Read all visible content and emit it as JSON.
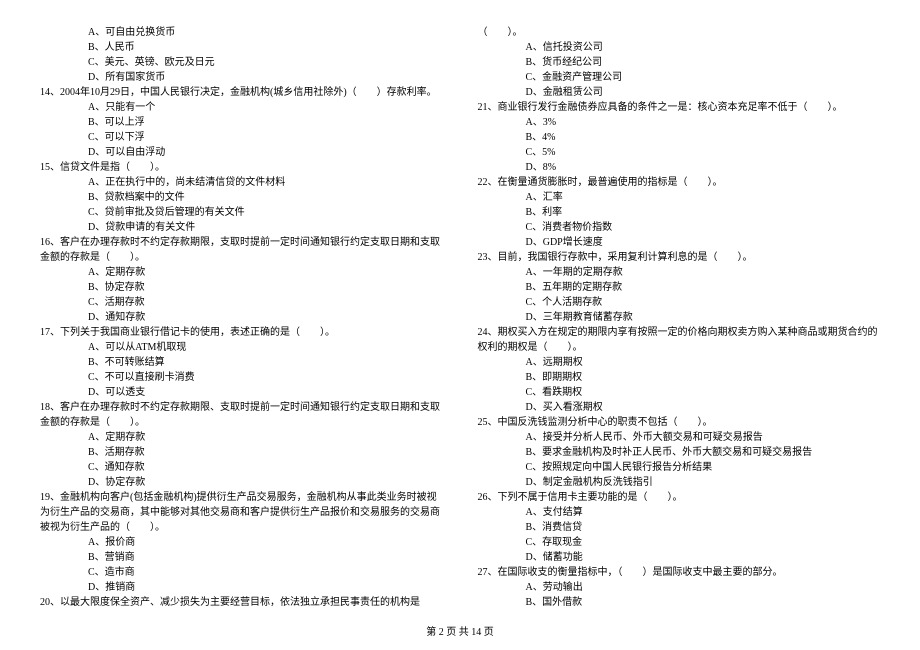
{
  "left": {
    "opts13": [
      "A、可自由兑换货币",
      "B、人民币",
      "C、美元、英镑、欧元及日元",
      "D、所有国家货币"
    ],
    "q14": "14、2004年10月29日，中国人民银行决定，金融机构(城乡信用社除外)（　　）存款利率。",
    "opts14": [
      "A、只能有一个",
      "B、可以上浮",
      "C、可以下浮",
      "D、可以自由浮动"
    ],
    "q15": "15、信贷文件是指（　　）。",
    "opts15": [
      "A、正在执行中的，尚未结清信贷的文件材料",
      "B、贷款档案中的文件",
      "C、贷前审批及贷后管理的有关文件",
      "D、贷款申请的有关文件"
    ],
    "q16": "16、客户在办理存款时不约定存款期限，支取时提前一定时间通知银行约定支取日期和支取金额的存款是（　　）。",
    "opts16": [
      "A、定期存款",
      "B、协定存款",
      "C、活期存款",
      "D、通知存款"
    ],
    "q17": "17、下列关于我国商业银行借记卡的使用，表述正确的是（　　）。",
    "opts17": [
      "A、可以从ATM机取现",
      "B、不可转账结算",
      "C、不可以直接刷卡消费",
      "D、可以透支"
    ],
    "q18": "18、客户在办理存款时不约定存款期限、支取时提前一定时间通知银行约定支取日期和支取金额的存款是（　　）。",
    "opts18": [
      "A、定期存款",
      "B、活期存款",
      "C、通知存款",
      "D、协定存款"
    ],
    "q19": "19、金融机构向客户(包括金融机构)提供衍生产品交易服务，金融机构从事此类业务时被视为衍生产品的交易商，其中能够对其他交易商和客户提供衍生产品报价和交易服务的交易商被视为衍生产品的（　　）。",
    "opts19": [
      "A、报价商",
      "B、营销商",
      "C、造市商",
      "D、推销商"
    ],
    "q20": "20、以最大限度保全资产、减少损失为主要经营目标，依法独立承担民事责任的机构是"
  },
  "right": {
    "q20cont": "（　　）。",
    "opts20": [
      "A、信托投资公司",
      "B、货币经纪公司",
      "C、金融资产管理公司",
      "D、金融租赁公司"
    ],
    "q21": "21、商业银行发行金融债券应具备的条件之一是：核心资本充足率不低于（　　）。",
    "opts21": [
      "A、3%",
      "B、4%",
      "C、5%",
      "D、8%"
    ],
    "q22": "22、在衡量通货膨胀时，最普遍使用的指标是（　　）。",
    "opts22": [
      "A、汇率",
      "B、利率",
      "C、消费者物价指数",
      "D、GDP增长速度"
    ],
    "q23": "23、目前，我国银行存款中，采用复利计算利息的是（　　）。",
    "opts23": [
      "A、一年期的定期存款",
      "B、五年期的定期存款",
      "C、个人活期存款",
      "D、三年期教育储蓄存款"
    ],
    "q24": "24、期权买入方在规定的期限内享有按照一定的价格向期权卖方购入某种商品或期货合约的权利的期权是（　　）。",
    "opts24": [
      "A、远期期权",
      "B、即期期权",
      "C、看跌期权",
      "D、买入看涨期权"
    ],
    "q25": "25、中国反洗钱监测分析中心的职责不包括（　　）。",
    "opts25": [
      "A、接受并分析人民币、外币大额交易和可疑交易报告",
      "B、要求金融机构及时补正人民币、外币大额交易和可疑交易报告",
      "C、按照规定向中国人民银行报告分析结果",
      "D、制定金融机构反洗钱指引"
    ],
    "q26": "26、下列不属于信用卡主要功能的是（　　）。",
    "opts26": [
      "A、支付结算",
      "B、消费信贷",
      "C、存取现金",
      "D、储蓄功能"
    ],
    "q27": "27、在国际收支的衡量指标中，（　　）是国际收支中最主要的部分。",
    "opts27": [
      "A、劳动输出",
      "B、国外借款"
    ]
  },
  "footer": "第 2 页 共 14 页"
}
